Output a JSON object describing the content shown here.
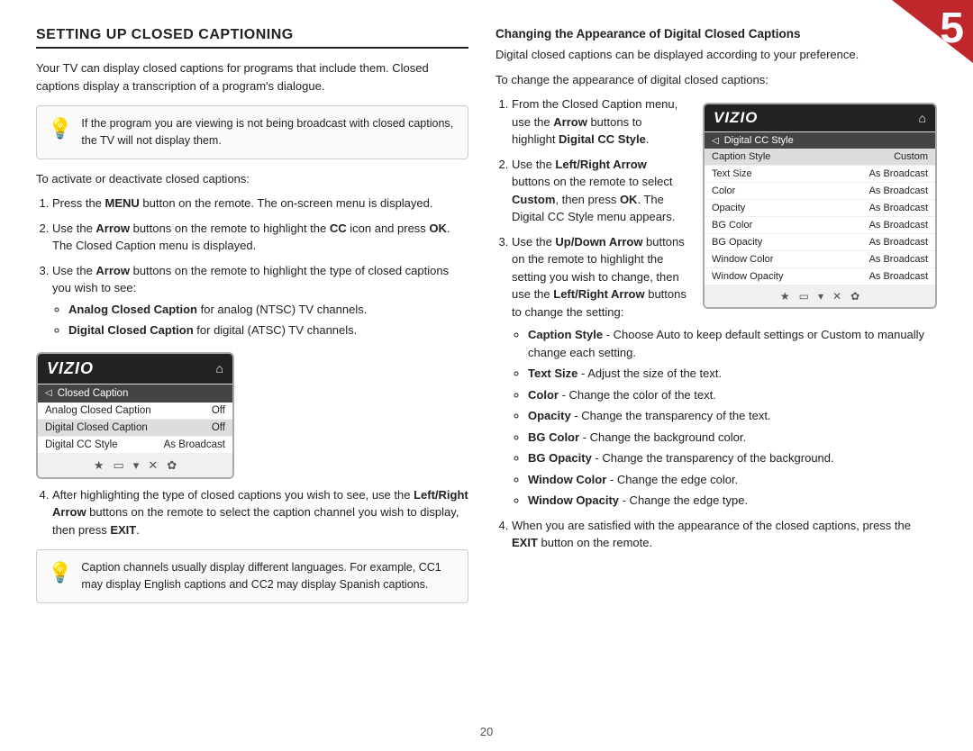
{
  "page": {
    "number": "5",
    "page_num_label": "20"
  },
  "left": {
    "title": "SETTING UP CLOSED CAPTIONING",
    "intro": "Your TV can display closed captions for programs that include them. Closed captions display a transcription of a program's dialogue.",
    "info_box": "If the program you are viewing is not being broadcast with closed captions, the TV will not display them.",
    "info_box2": "Caption channels usually display different languages. For example, CC1 may display English captions and CC2 may display Spanish captions.",
    "steps": [
      {
        "id": 1,
        "text_parts": [
          "Press the ",
          "MENU",
          " button on the remote. The on-screen menu is displayed."
        ]
      },
      {
        "id": 2,
        "text_parts": [
          "Use the ",
          "Arrow",
          " buttons on the remote to highlight the ",
          "CC",
          " icon and press ",
          "OK",
          ". The Closed Caption menu is displayed."
        ]
      },
      {
        "id": 3,
        "text_parts": [
          "Use the ",
          "Arrow",
          " buttons on the remote to highlight the type of closed captions you wish to see:"
        ],
        "bullets": [
          {
            "bold": "Analog Closed Caption",
            "text": " for analog (NTSC) TV channels."
          },
          {
            "bold": "Digital Closed Caption",
            "text": " for digital (ATSC) TV channels."
          }
        ]
      },
      {
        "id": 4,
        "text_parts": [
          "After highlighting the type of closed captions you wish to see, use the ",
          "Left/Right Arrow",
          " buttons on the remote to select the caption channel you wish to display, then press ",
          "EXIT",
          "."
        ]
      }
    ],
    "tv_mockup": {
      "logo": "VIZIO",
      "header_item": "Closed Caption",
      "rows": [
        {
          "label": "Analog Closed Caption",
          "value": "Off"
        },
        {
          "label": "Digital Closed Caption",
          "value": "Off"
        },
        {
          "label": "Digital CC Style",
          "value": "As Broadcast"
        }
      ],
      "footer_icons": [
        "★",
        "▭",
        "▾",
        "✕",
        "✿"
      ]
    }
  },
  "right": {
    "sub_heading": "Changing the Appearance of Digital Closed Captions",
    "para1": "Digital closed captions can be displayed according to your preference.",
    "para2": "To change the appearance of digital closed captions:",
    "steps": [
      {
        "id": 1,
        "text_parts": [
          "From the Closed Caption menu, use the ",
          "Arrow",
          " buttons to highlight ",
          "Digital CC Style",
          "."
        ]
      },
      {
        "id": 2,
        "text_parts": [
          "Use the ",
          "Left/Right Arrow",
          " buttons on the remote to select ",
          "Custom",
          ", then press ",
          "OK",
          ". The Digital CC Style menu appears."
        ]
      },
      {
        "id": 3,
        "text_parts": [
          "Use the ",
          "Up/Down Arrow",
          " buttons on the remote to highlight the setting you wish to change, then use the ",
          "Left/Right Arrow",
          " buttons to change the setting:"
        ],
        "bullets": [
          {
            "bold": "Caption Style",
            "text": " - Choose Auto to keep default settings or Custom to manually change each setting."
          },
          {
            "bold": "Text Size",
            "text": " - Adjust the size of the text."
          },
          {
            "bold": "Color",
            "text": " - Change the color of the text."
          },
          {
            "bold": "Opacity",
            "text": " - Change the transparency of the text."
          },
          {
            "bold": "BG Color",
            "text": " - Change the background color."
          },
          {
            "bold": "BG Opacity",
            "text": " - Change the transparency of the background."
          },
          {
            "bold": "Window Color",
            "text": " - Change the edge color."
          },
          {
            "bold": "Window Opacity",
            "text": " - Change the edge type."
          }
        ]
      },
      {
        "id": 4,
        "text_parts": [
          "When you are satisfied with the appearance of the closed captions, press the ",
          "EXIT",
          " button on the remote."
        ]
      }
    ],
    "tv_mockup": {
      "logo": "VIZIO",
      "header_item": "Digital CC Style",
      "rows": [
        {
          "label": "Caption Style",
          "value": "Custom"
        },
        {
          "label": "Text Size",
          "value": "As Broadcast"
        },
        {
          "label": "Color",
          "value": "As Broadcast"
        },
        {
          "label": "Opacity",
          "value": "As Broadcast"
        },
        {
          "label": "BG Color",
          "value": "As Broadcast"
        },
        {
          "label": "BG Opacity",
          "value": "As Broadcast"
        },
        {
          "label": "Window Color",
          "value": "As Broadcast"
        },
        {
          "label": "Window Opacity",
          "value": "As Broadcast"
        }
      ],
      "footer_icons": [
        "★",
        "▭",
        "▾",
        "✕",
        "✿"
      ]
    }
  }
}
